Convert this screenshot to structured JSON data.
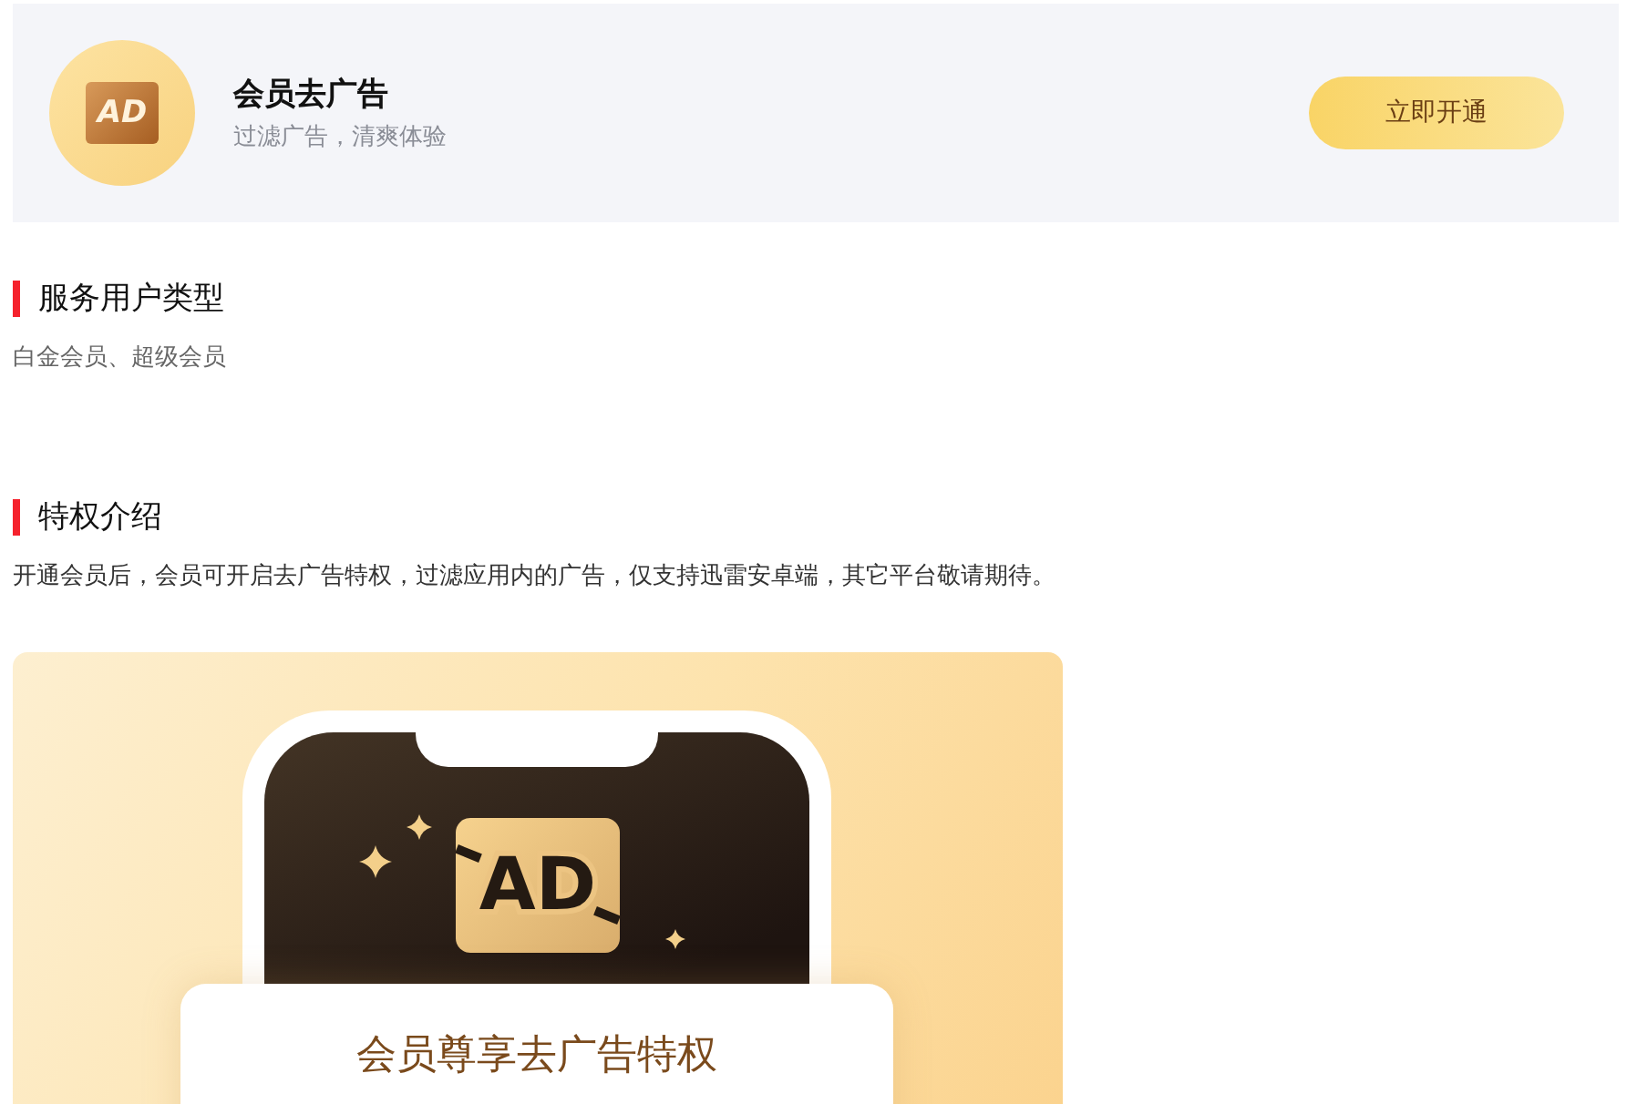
{
  "header": {
    "icon_text": "AD",
    "title": "会员去广告",
    "subtitle": "过滤广告，清爽体验",
    "button": "立即开通"
  },
  "sections": [
    {
      "title": "服务用户类型",
      "text": "白金会员、超级会员",
      "kind": "muted"
    },
    {
      "title": "特权介绍",
      "text": "开通会员后，会员可开启去广告特权，过滤应用内的广告，仅支持迅雷安卓端，其它平台敬请期待。",
      "kind": "plain"
    }
  ],
  "banner": {
    "badge_text": "AD",
    "caption": "会员尊享去广告特权"
  }
}
